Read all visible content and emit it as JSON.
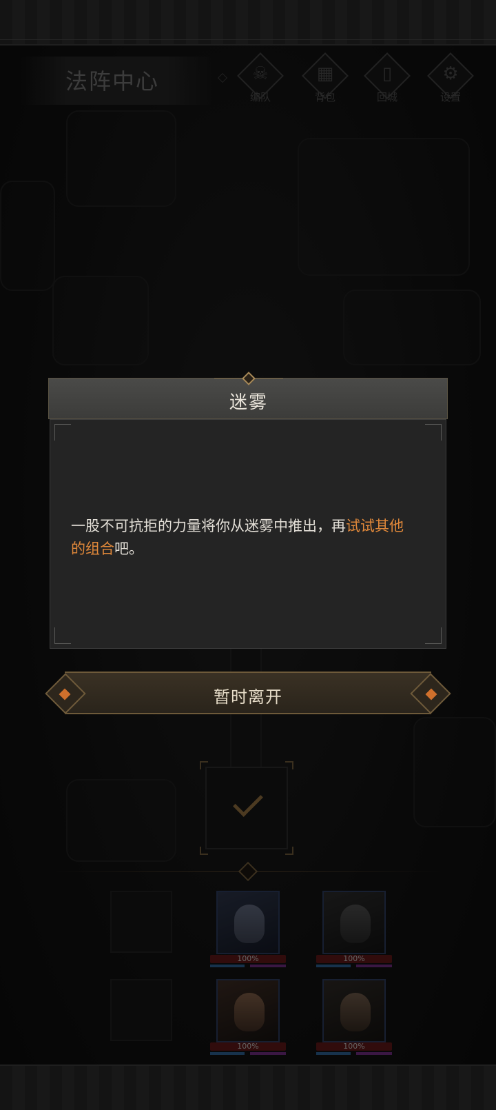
{
  "header": {
    "title": "法阵中心",
    "nav": [
      {
        "glyph": "☠",
        "label": "编队"
      },
      {
        "glyph": "▦",
        "label": "背包"
      },
      {
        "glyph": "▯",
        "label": "回城"
      },
      {
        "glyph": "⚙",
        "label": "设置"
      }
    ]
  },
  "dialog": {
    "title": "迷雾",
    "message": {
      "part1": "一股不可抗拒的力量将你从迷雾中推出，再",
      "highlight1": "试试其他",
      "highlight2": "的组合",
      "part2": "吧。"
    },
    "highlight_color": "#e0883a"
  },
  "leave_button": {
    "label": "暂时离开"
  },
  "party": {
    "heroes": [
      {
        "hp": "100%"
      },
      {
        "hp": "100%"
      },
      {
        "hp": "100%"
      },
      {
        "hp": "100%"
      }
    ]
  }
}
